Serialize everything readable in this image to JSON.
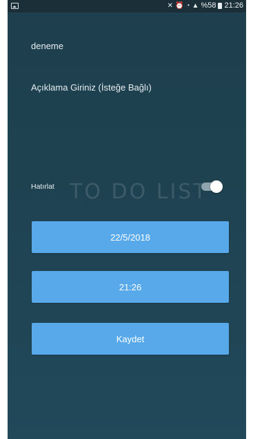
{
  "status_bar": {
    "battery_percent": "%58",
    "time": "21:26",
    "icons": [
      "image-icon",
      "mute-icon",
      "alarm-icon",
      "wifi-icon",
      "signal-icon",
      "battery-icon"
    ]
  },
  "form": {
    "title_value": "deneme",
    "description_placeholder": "Açıklama Giriniz (İsteğe Bağlı)",
    "remind_label": "Hatırlat",
    "remind_on": true,
    "watermark": "TO DO LIST",
    "date_button": "22/5/2018",
    "time_button": "21:26",
    "save_button": "Kaydet"
  },
  "colors": {
    "background": "#1f4352",
    "button": "#58a9ea",
    "status_bar": "#1a2f38"
  }
}
